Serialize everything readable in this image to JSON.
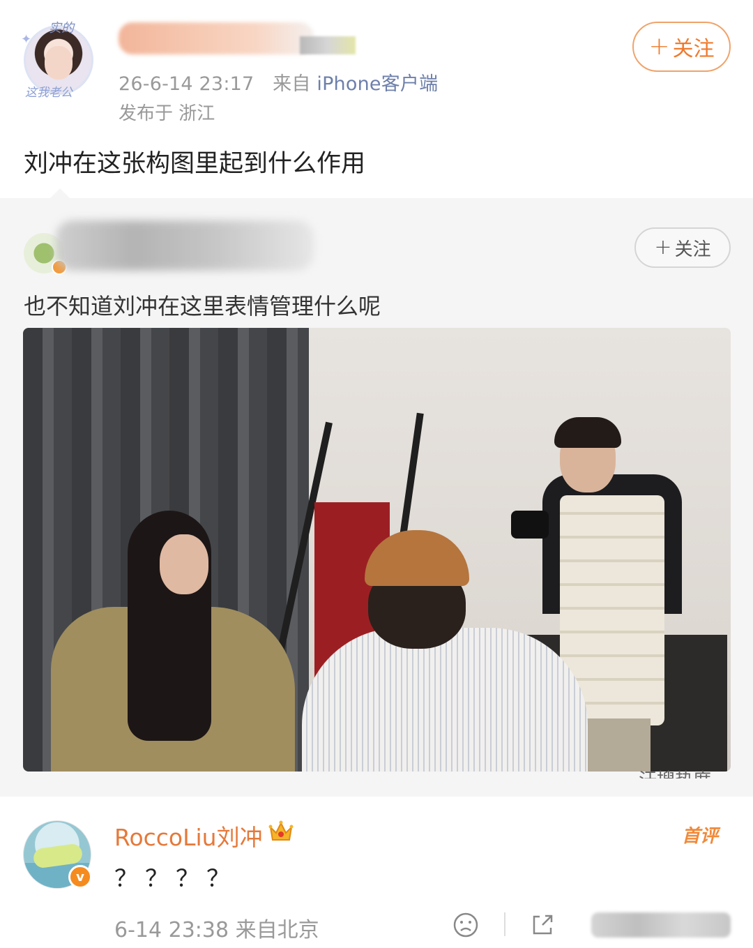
{
  "post": {
    "author_name": "",
    "avatar_tag_top": "实的",
    "avatar_tag_bottom": "这我老公",
    "timestamp": "26-6-14 23:17",
    "from_prefix": "来自",
    "source": "iPhone客户端",
    "location": "发布于 浙江",
    "follow_label": "关注",
    "text": "刘冲在这张构图里起到什么作用"
  },
  "retweet": {
    "follow_label": "关注",
    "text": "也不知道刘冲在这里表情管理什么呢",
    "hot_label": "汗搜热度"
  },
  "comment": {
    "author_name": "RoccoLiu刘冲",
    "first_comment_label": "首评",
    "text": "？？？？",
    "time": "6-14 23:38 来自北京",
    "verified_mark": "v"
  },
  "icons": {
    "follow_plus": "plus-icon",
    "crown": "crown-icon",
    "emoji": "emoji-icon",
    "share": "share-icon"
  },
  "colors": {
    "accent_orange": "#ef7a2c",
    "source_blue": "#6d7faa",
    "retweet_bg": "#f5f5f5"
  }
}
